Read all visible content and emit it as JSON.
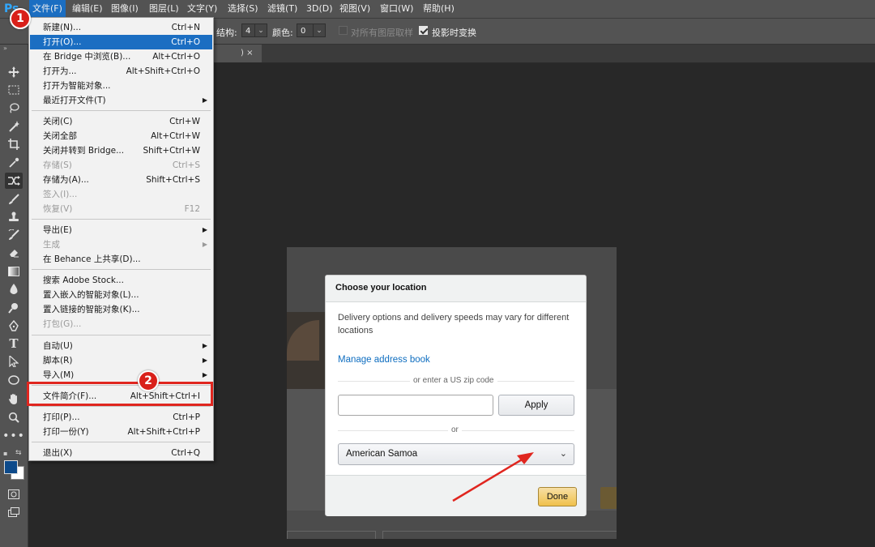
{
  "app": {
    "logo": "Ps",
    "menus": [
      "文件(F)",
      "编辑(E)",
      "图像(I)",
      "图层(L)",
      "文字(Y)",
      "选择(S)",
      "滤镜(T)",
      "3D(D)",
      "视图(V)",
      "窗口(W)",
      "帮助(H)"
    ],
    "active_menu": "文件(F)"
  },
  "options_bar": {
    "structure_label": "结构:",
    "structure_value": "4",
    "color_label": "颜色:",
    "color_value": "0",
    "sample_all_layers": "对所有图层取样",
    "sample_all_layers_checked": false,
    "transform_on_drop": "投影时变换",
    "transform_on_drop_checked": true
  },
  "document_tab": {
    "suffix": ") ×"
  },
  "file_menu": {
    "items": [
      {
        "label": "新建(N)...",
        "shortcut": "Ctrl+N"
      },
      {
        "label": "打开(O)...",
        "shortcut": "Ctrl+O",
        "highlighted": true
      },
      {
        "label": "在 Bridge 中浏览(B)...",
        "shortcut": "Alt+Ctrl+O"
      },
      {
        "label": "打开为...",
        "shortcut": "Alt+Shift+Ctrl+O"
      },
      {
        "label": "打开为智能对象...",
        "shortcut": ""
      },
      {
        "label": "最近打开文件(T)",
        "shortcut": "",
        "submenu": true
      },
      {
        "label": "关闭(C)",
        "shortcut": "Ctrl+W"
      },
      {
        "label": "关闭全部",
        "shortcut": "Alt+Ctrl+W"
      },
      {
        "label": "关闭并转到 Bridge...",
        "shortcut": "Shift+Ctrl+W"
      },
      {
        "label": "存储(S)",
        "shortcut": "Ctrl+S",
        "disabled": true
      },
      {
        "label": "存储为(A)...",
        "shortcut": "Shift+Ctrl+S"
      },
      {
        "label": "签入(I)...",
        "shortcut": "",
        "disabled": true
      },
      {
        "label": "恢复(V)",
        "shortcut": "F12",
        "disabled": true
      },
      {
        "label": "导出(E)",
        "shortcut": "",
        "submenu": true
      },
      {
        "label": "生成",
        "shortcut": "",
        "submenu": true,
        "disabled": true
      },
      {
        "label": "在 Behance 上共享(D)...",
        "shortcut": ""
      },
      {
        "label": "搜索 Adobe Stock...",
        "shortcut": ""
      },
      {
        "label": "置入嵌入的智能对象(L)...",
        "shortcut": ""
      },
      {
        "label": "置入链接的智能对象(K)...",
        "shortcut": ""
      },
      {
        "label": "打包(G)...",
        "shortcut": "",
        "disabled": true
      },
      {
        "label": "自动(U)",
        "shortcut": "",
        "submenu": true
      },
      {
        "label": "脚本(R)",
        "shortcut": "",
        "submenu": true
      },
      {
        "label": "导入(M)",
        "shortcut": "",
        "submenu": true
      },
      {
        "label": "文件简介(F)...",
        "shortcut": "Alt+Shift+Ctrl+I"
      },
      {
        "label": "打印(P)...",
        "shortcut": "Ctrl+P"
      },
      {
        "label": "打印一份(Y)",
        "shortcut": "Alt+Shift+Ctrl+P"
      },
      {
        "label": "退出(X)",
        "shortcut": "Ctrl+Q"
      }
    ]
  },
  "annotations": {
    "badge1": "1",
    "badge2": "2"
  },
  "dialog": {
    "title": "Choose your location",
    "description": "Delivery options and delivery speeds may vary for different locations",
    "manage_link": "Manage address book",
    "zip_divider": "or enter a US zip code",
    "zip_value": "",
    "apply_label": "Apply",
    "or_divider": "or",
    "selected_country": "American Samoa",
    "done_label": "Done"
  },
  "colors": {
    "accent": "#1b6ec2",
    "annotation_red": "#e0261f",
    "link": "#0f6ec0",
    "done_yellow": "#f0c14b"
  },
  "tools": [
    "move-icon",
    "marquee-icon",
    "lasso-icon",
    "magic-wand-icon",
    "crop-icon",
    "eyedropper-icon",
    "content-aware-move-icon",
    "brush-icon",
    "stamp-icon",
    "history-brush-icon",
    "eraser-icon",
    "gradient-icon",
    "blur-icon",
    "dodge-icon",
    "pen-icon",
    "type-icon",
    "path-select-icon",
    "ellipse-icon",
    "hand-icon",
    "zoom-icon",
    "more-icon"
  ]
}
